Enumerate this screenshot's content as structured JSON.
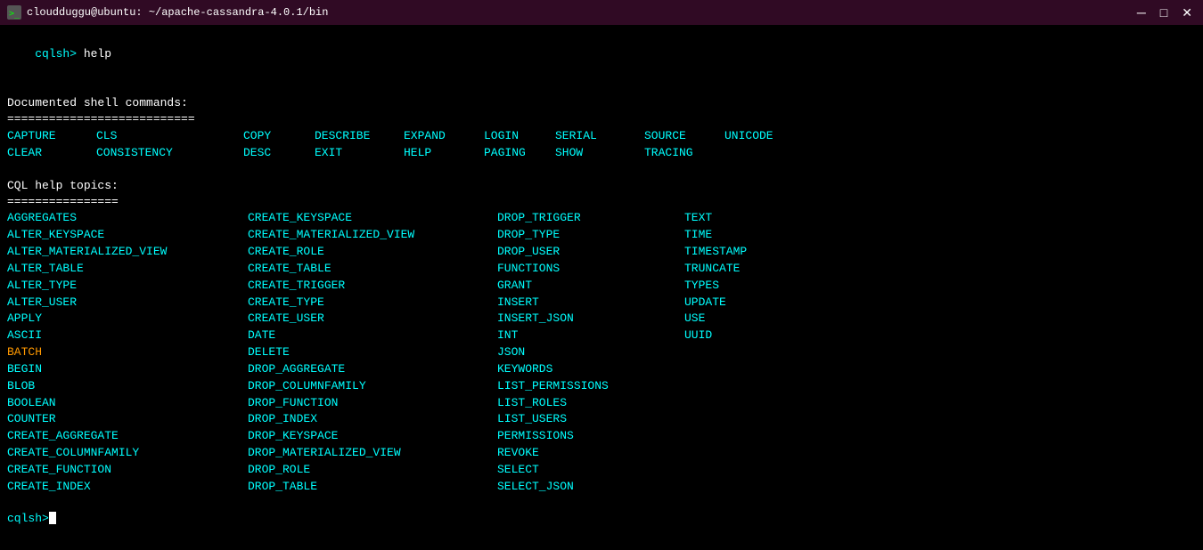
{
  "titlebar": {
    "title": "cloudduggu@ubuntu: ~/apache-cassandra-4.0.1/bin",
    "minimize": "─",
    "maximize": "□",
    "close": "✕"
  },
  "terminal": {
    "prompt1": "cqlsh> ",
    "cmd1": "help",
    "documented_header": "Documented shell commands:",
    "divider1": "===========================",
    "shell_commands": [
      [
        "CAPTURE",
        "CLS",
        "COPY",
        "DESCRIBE",
        "EXPAND",
        "LOGIN",
        "SERIAL",
        "SOURCE",
        "UNICODE"
      ],
      [
        "CLEAR",
        "CONSISTENCY",
        "DESC",
        "EXIT",
        "HELP",
        "PAGING",
        "SHOW",
        "TRACING",
        ""
      ]
    ],
    "cql_header": "CQL help topics:",
    "divider2": "================",
    "topics": [
      [
        "AGGREGATES",
        "CREATE_KEYSPACE",
        "DROP_TRIGGER",
        "TEXT"
      ],
      [
        "ALTER_KEYSPACE",
        "CREATE_MATERIALIZED_VIEW",
        "DROP_TYPE",
        "TIME"
      ],
      [
        "ALTER_MATERIALIZED_VIEW",
        "CREATE_ROLE",
        "DROP_USER",
        "TIMESTAMP"
      ],
      [
        "ALTER_TABLE",
        "CREATE_TABLE",
        "FUNCTIONS",
        "TRUNCATE"
      ],
      [
        "ALTER_TYPE",
        "CREATE_TRIGGER",
        "GRANT",
        "TYPES"
      ],
      [
        "ALTER_USER",
        "CREATE_TYPE",
        "INSERT",
        "UPDATE"
      ],
      [
        "APPLY",
        "CREATE_USER",
        "INSERT_JSON",
        "USE"
      ],
      [
        "ASCII",
        "DATE",
        "INT",
        "UUID"
      ],
      [
        "BATCH",
        "DELETE",
        "JSON",
        ""
      ],
      [
        "BEGIN",
        "DROP_AGGREGATE",
        "KEYWORDS",
        ""
      ],
      [
        "BLOB",
        "DROP_COLUMNFAMILY",
        "LIST_PERMISSIONS",
        ""
      ],
      [
        "BOOLEAN",
        "DROP_FUNCTION",
        "LIST_ROLES",
        ""
      ],
      [
        "COUNTER",
        "DROP_INDEX",
        "LIST_USERS",
        ""
      ],
      [
        "CREATE_AGGREGATE",
        "DROP_KEYSPACE",
        "PERMISSIONS",
        ""
      ],
      [
        "CREATE_COLUMNFAMILY",
        "DROP_MATERIALIZED_VIEW",
        "REVOKE",
        ""
      ],
      [
        "CREATE_FUNCTION",
        "DROP_ROLE",
        "SELECT",
        ""
      ],
      [
        "CREATE_INDEX",
        "DROP_TABLE",
        "SELECT_JSON",
        ""
      ]
    ],
    "orange_topics": [
      "BATCH"
    ],
    "prompt2": "cqlsh> "
  }
}
